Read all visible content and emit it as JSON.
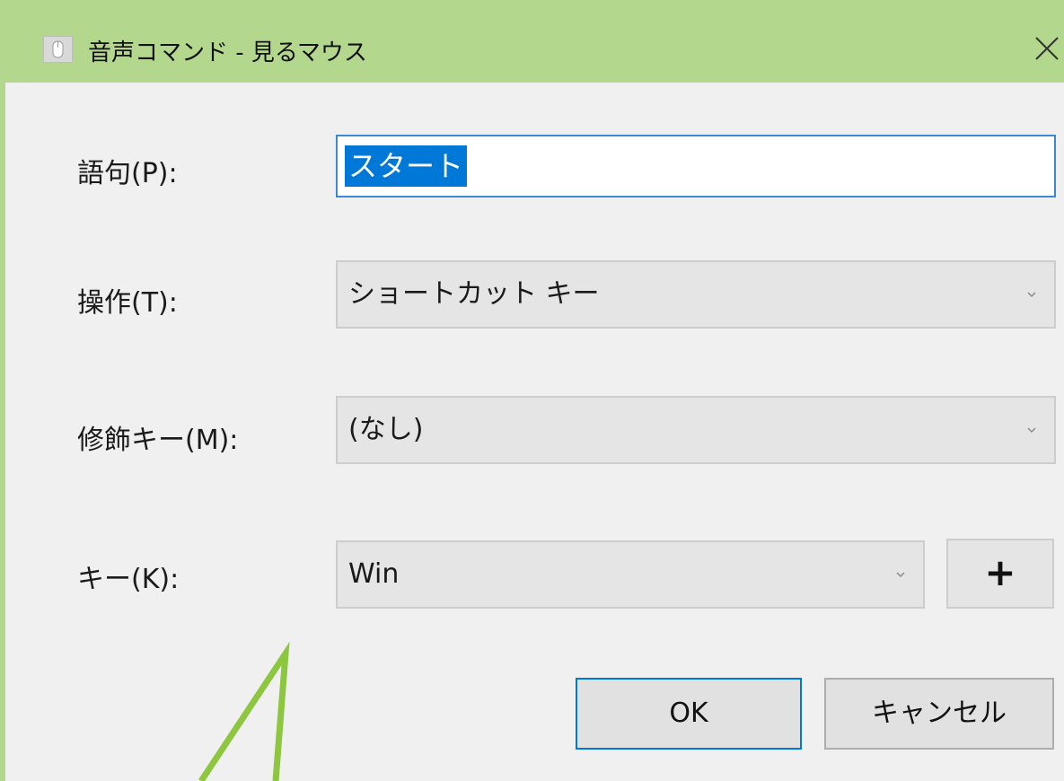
{
  "window": {
    "title": "音声コマンド - 見るマウス",
    "title_bar_color": "#b3d78d",
    "icon": "mouse-icon",
    "close_icon": "close-icon"
  },
  "form": {
    "phrase": {
      "label": "語句(P):",
      "value": "スタート"
    },
    "action": {
      "label": "操作(T):",
      "value": "ショートカット キー"
    },
    "modifier": {
      "label": "修飾キー(M):",
      "value": "(なし)"
    },
    "key": {
      "label": "キー(K):",
      "value": "Win",
      "add_label": "+"
    }
  },
  "buttons": {
    "ok": "OK",
    "cancel": "キャンセル"
  },
  "annotation": {
    "color": "#8dc63f",
    "shape": "callout-pointer"
  }
}
